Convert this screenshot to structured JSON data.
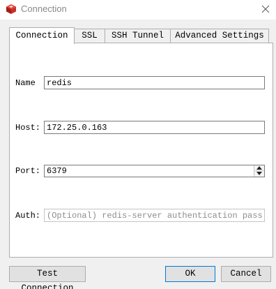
{
  "window": {
    "title": "Connection"
  },
  "tabs": [
    {
      "label": "Connection"
    },
    {
      "label": "SSL"
    },
    {
      "label": "SSH Tunnel"
    },
    {
      "label": "Advanced Settings"
    }
  ],
  "form": {
    "name": {
      "label": "Name",
      "value": "redis"
    },
    "host": {
      "label": "Host:",
      "value": "172.25.0.163"
    },
    "port": {
      "label": "Port:",
      "value": "6379"
    },
    "auth": {
      "label": "Auth:",
      "value": "",
      "placeholder": "(Optional) redis-server authentication password"
    }
  },
  "buttons": {
    "test_connection": "Test Connection",
    "ok": "OK",
    "cancel": "Cancel"
  },
  "icons": {
    "app": "redis-cube-icon",
    "close": "close-icon"
  },
  "colors": {
    "app_icon_red": "#c6302b",
    "default_button_border": "#0078d7"
  }
}
